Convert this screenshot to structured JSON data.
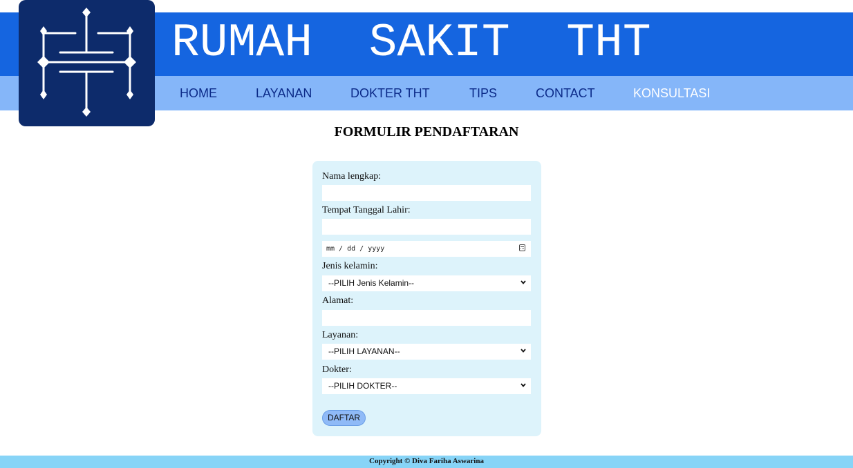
{
  "header": {
    "title": "RUMAH  SAKIT  THT",
    "logo_icon": "hospital-tht-logo-icon"
  },
  "nav": {
    "items": [
      {
        "label": "HOME"
      },
      {
        "label": "LAYANAN"
      },
      {
        "label": "DOKTER THT"
      },
      {
        "label": "TIPS"
      },
      {
        "label": "CONTACT"
      },
      {
        "label": "KONSULTASI",
        "active": true
      }
    ]
  },
  "form": {
    "title": "FORMULIR PENDAFTARAN",
    "nama_label": "Nama lengkap:",
    "nama_value": "",
    "ttl_label": "Tempat Tanggal Lahir:",
    "ttl_value": "",
    "date_placeholder": "mm / dd / yyyy",
    "jk_label": "Jenis kelamin:",
    "jk_selected": "--PILIH Jenis Kelamin--",
    "alamat_label": "Alamat:",
    "alamat_value": "",
    "layanan_label": "Layanan:",
    "layanan_selected": "--PILIH LAYANAN--",
    "dokter_label": "Dokter:",
    "dokter_selected": "--PILIH DOKTER--",
    "submit_label": "DAFTAR"
  },
  "footer": {
    "copyright": "Copyright © Diva Fariha Aswarina"
  },
  "colors": {
    "header_bg": "#1565e0",
    "nav_bg": "#85b6f9",
    "logo_bg": "#0d2b6b",
    "nav_text": "#0b2a88",
    "card_bg": "#ddf3fb",
    "footer_bg": "#87d4f7",
    "button_bg": "#8fbaf7"
  }
}
